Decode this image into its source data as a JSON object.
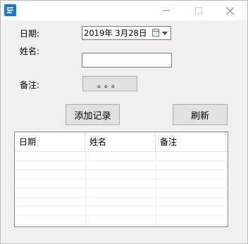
{
  "form": {
    "date_label": "日期:",
    "date_value": "2019年  3月28日",
    "name_label": "姓名:",
    "name_value": "",
    "note_label": "备注:",
    "note_button_label": "。。。"
  },
  "actions": {
    "add_label": "添加记录",
    "refresh_label": "刷新"
  },
  "list": {
    "columns": [
      "日期",
      "姓名",
      "备注"
    ],
    "rows": []
  },
  "titlebar": {
    "icons": [
      "app-icon",
      "minimize-icon",
      "maximize-icon",
      "close-icon"
    ]
  }
}
